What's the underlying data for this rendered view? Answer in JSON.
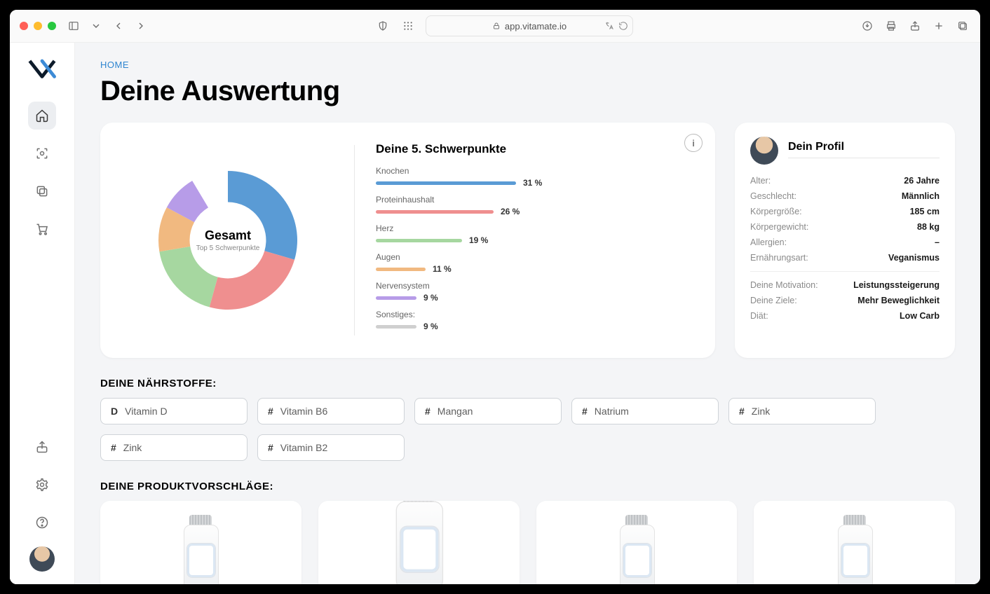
{
  "browser": {
    "url": "app.vitamate.io"
  },
  "breadcrumb": "HOME",
  "page_title": "Deine Auswertung",
  "summary": {
    "center_title": "Gesamt",
    "center_sub": "Top 5 Schwerpunkte",
    "panel_title": "Deine 5. Schwerpunkte",
    "items": [
      {
        "label": "Knochen",
        "pct": "31 %",
        "value": 31,
        "color": "#5a9bd5"
      },
      {
        "label": "Proteinhaushalt",
        "pct": "26 %",
        "value": 26,
        "color": "#ef8f8f"
      },
      {
        "label": "Herz",
        "pct": "19 %",
        "value": 19,
        "color": "#a6d7a0"
      },
      {
        "label": "Augen",
        "pct": "11 %",
        "value": 11,
        "color": "#f1b980"
      },
      {
        "label": "Nervensystem",
        "pct": "9 %",
        "value": 9,
        "color": "#b79ce8"
      },
      {
        "label": "Sonstiges:",
        "pct": "9 %",
        "value": 9,
        "color": "#cfcfcf"
      }
    ]
  },
  "chart_data": {
    "type": "pie",
    "title": "Gesamt",
    "subtitle": "Top 5 Schwerpunkte",
    "series": [
      {
        "name": "Knochen",
        "value": 31,
        "color": "#5a9bd5"
      },
      {
        "name": "Proteinhaushalt",
        "value": 26,
        "color": "#ef8f8f"
      },
      {
        "name": "Herz",
        "value": 19,
        "color": "#a6d7a0"
      },
      {
        "name": "Augen",
        "value": 11,
        "color": "#f1b980"
      },
      {
        "name": "Nervensystem",
        "value": 9,
        "color": "#b79ce8"
      },
      {
        "name": "Sonstiges",
        "value": 9,
        "color": "#ffffff"
      }
    ],
    "donut_inner_ratio": 0.55
  },
  "profile": {
    "title": "Dein Profil",
    "rows": [
      {
        "k": "Alter:",
        "v": "26 Jahre"
      },
      {
        "k": "Geschlecht:",
        "v": "Männlich"
      },
      {
        "k": "Körpergröße:",
        "v": "185 cm"
      },
      {
        "k": "Körpergewicht:",
        "v": "88 kg"
      },
      {
        "k": "Allergien:",
        "v": "–"
      },
      {
        "k": "Ernährungsart:",
        "v": "Veganismus"
      }
    ],
    "rows2": [
      {
        "k": "Deine Motivation:",
        "v": "Leistungssteigerung"
      },
      {
        "k": "Deine Ziele:",
        "v": "Mehr Beweglichkeit"
      },
      {
        "k": "Diät:",
        "v": "Low Carb"
      }
    ]
  },
  "nutrients": {
    "title": "DEINE NÄHRSTOFFE:",
    "items": [
      {
        "tag": "D",
        "label": "Vitamin D"
      },
      {
        "tag": "#",
        "label": "Vitamin B6"
      },
      {
        "tag": "#",
        "label": "Mangan"
      },
      {
        "tag": "#",
        "label": "Natrium"
      },
      {
        "tag": "#",
        "label": "Zink"
      },
      {
        "tag": "#",
        "label": "Zink"
      },
      {
        "tag": "#",
        "label": "Vitamin B2"
      }
    ]
  },
  "products": {
    "title": "DEINE PRODUKTVORSCHLÄGE:",
    "count": 4
  }
}
